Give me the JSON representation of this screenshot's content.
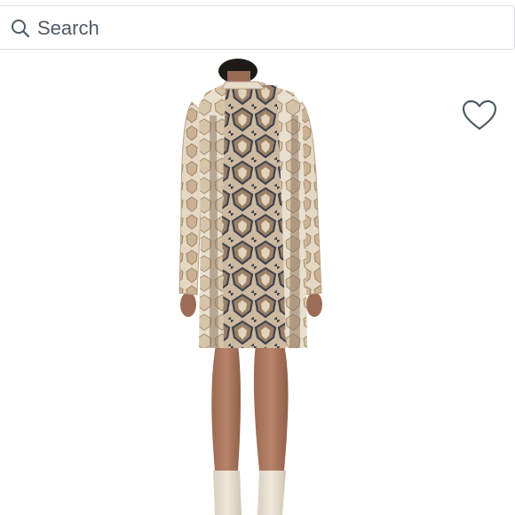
{
  "search": {
    "placeholder": "Search",
    "value": ""
  },
  "icons": {
    "search": "search-icon",
    "favorite": "heart-outline-icon"
  },
  "colors": {
    "icon_stroke": "#4f5a66",
    "border": "#d9dbdf",
    "background": "#ffffff"
  }
}
